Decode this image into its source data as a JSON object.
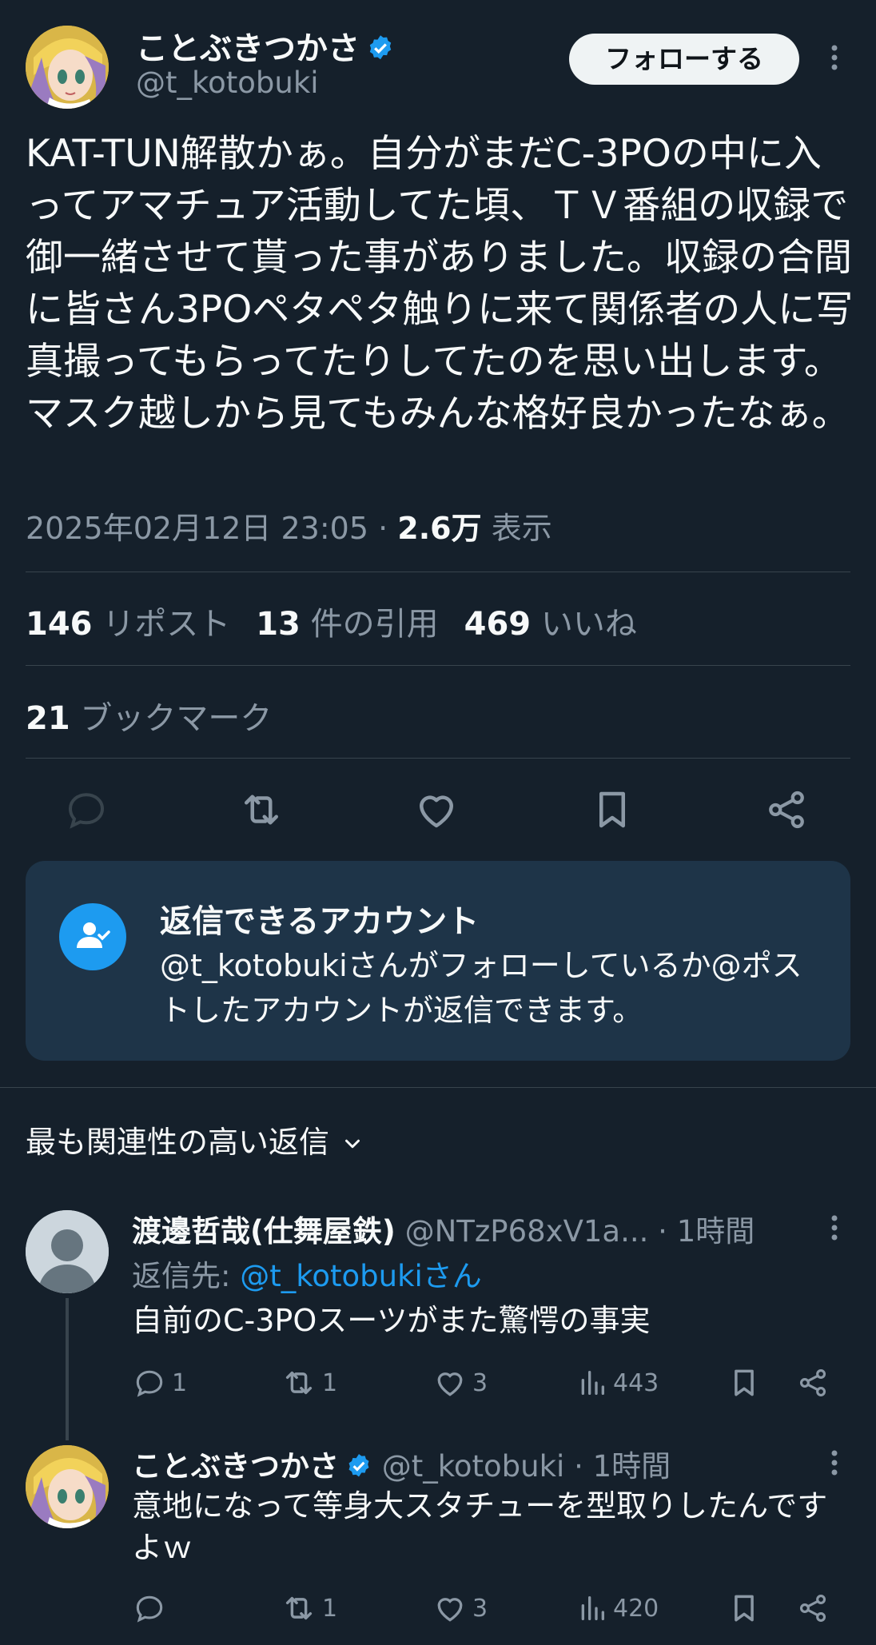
{
  "post": {
    "author_name": "ことぶきつかさ",
    "author_handle": "@t_kotobuki",
    "follow_label": "フォローする",
    "text": "KAT-TUN解散かぁ。自分がまだC-3POの中に入ってアマチュア活動してた頃、ＴＶ番組の収録で御一緒させて貰った事がありました。収録の合間に皆さん3POペタペタ触りに来て関係者の人に写真撮ってもらってたりしてたのを思い出します。マスク越しから見てもみんな格好良かったなぁ。",
    "timestamp": "2025年02月12日 23:05",
    "separator": "·",
    "views_count": "2.6万",
    "views_label": "表示"
  },
  "stats": {
    "reposts_count": "146",
    "reposts_label": "リポスト",
    "quotes_count": "13",
    "quotes_label": "件の引用",
    "likes_count": "469",
    "likes_label": "いいね",
    "bookmarks_count": "21",
    "bookmarks_label": "ブックマーク"
  },
  "actions": [
    "reply-icon",
    "repost-icon",
    "like-icon",
    "bookmark-icon",
    "share-icon"
  ],
  "reply_restriction": {
    "title": "返信できるアカウント",
    "body": "@t_kotobukiさんがフォローしているか@ポストしたアカウントが返信できます。"
  },
  "sort_label": "最も関連性の高い返信",
  "replies": [
    {
      "name": "渡邊哲哉(仕舞屋鉄)",
      "handle": "@NTzP68xV1a...",
      "time": "· 1時間",
      "reply_to_prefix": "返信先: ",
      "reply_to_handle": "@t_kotobukiさん",
      "text": "自前のC-3POスーツがまた驚愕の事実",
      "reply_count": "1",
      "repost_count": "1",
      "like_count": "3",
      "view_count": "443"
    },
    {
      "name": "ことぶきつかさ",
      "handle": "@t_kotobuki",
      "time": "· 1時間",
      "text": "意地になって等身大スタチューを型取りしたんですよｗ",
      "reply_count": "",
      "repost_count": "1",
      "like_count": "3",
      "view_count": "420"
    }
  ],
  "colors": {
    "background": "#15202b",
    "accent": "#1d9bf0",
    "muted": "#8b98a5",
    "card": "#1e3448"
  }
}
